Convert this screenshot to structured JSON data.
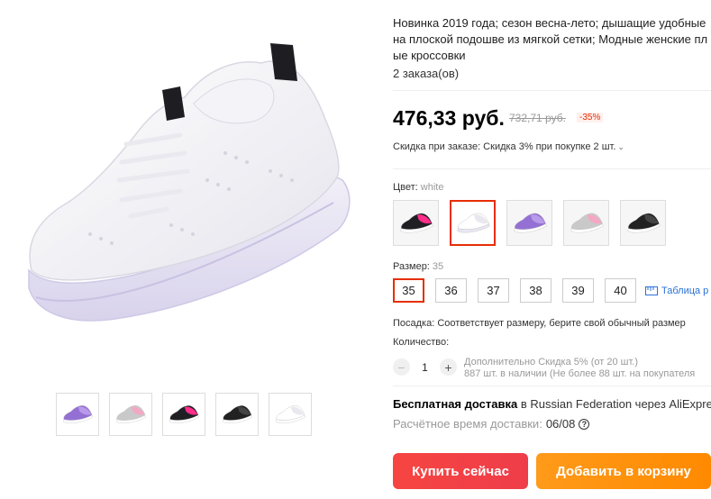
{
  "product": {
    "title_lines": [
      "Новинка 2019 года; сезон весна-лето; дышащие удобные",
      "на плоской подошве из мягкой сетки; Модные женские пл",
      "ые кроссовки"
    ],
    "orders": "2 заказа(ов)",
    "price": "476,33 руб.",
    "old_price": "732,71 руб.",
    "discount": "-35%",
    "promo": "Скидка при заказе: Скидка 3% при покупке 2 шт."
  },
  "color": {
    "label": "Цвет: ",
    "selected": "white",
    "options": [
      {
        "name": "black-pink",
        "body": "#1f1f24",
        "accent": "#ff2e8a",
        "sole": "#ffffff"
      },
      {
        "name": "white",
        "body": "#ffffff",
        "accent": "#e8e8ee",
        "sole": "#e9e6f4"
      },
      {
        "name": "purple",
        "body": "#9470d4",
        "accent": "#b89ae8",
        "sole": "#ffffff"
      },
      {
        "name": "grey-pink",
        "body": "#c9c9c9",
        "accent": "#f4a7c3",
        "sole": "#ffffff"
      },
      {
        "name": "black",
        "body": "#222222",
        "accent": "#444444",
        "sole": "#ffffff"
      }
    ]
  },
  "size": {
    "label": "Размер: ",
    "selected": "35",
    "options": [
      "35",
      "36",
      "37",
      "38",
      "39",
      "40"
    ],
    "table_link": "Таблица р"
  },
  "fit": "Посадка: Соответствует размеру, берите свой обычный размер",
  "quantity": {
    "label": "Количество:",
    "value": "1",
    "minus": "−",
    "plus": "+",
    "note_line1": "Дополнительно Скидка 5% (от 20 шт.)",
    "note_line2": "887 шт. в наличии (Не более 88 шт. на покупателя"
  },
  "shipping": {
    "bold": "Бесплатная доставка",
    "rest": " в Russian Federation через AliExpre",
    "eta_label": "Расчётное время доставки: ",
    "eta_date": "06/08",
    "help": "?"
  },
  "buttons": {
    "buy": "Купить сейчас",
    "cart": "Добавить в корзину"
  },
  "thumbnails": [
    {
      "name": "purple",
      "body": "#9470d4",
      "accent": "#b89ae8"
    },
    {
      "name": "grey-pink",
      "body": "#c9c9c9",
      "accent": "#f4a7c3"
    },
    {
      "name": "black-pink",
      "body": "#1f1f24",
      "accent": "#ff2e8a"
    },
    {
      "name": "black",
      "body": "#222222",
      "accent": "#444444"
    },
    {
      "name": "white",
      "body": "#ffffff",
      "accent": "#e8e8ee"
    }
  ],
  "colors": {
    "accent_red": "#e62e04",
    "buy_button": "#f64541",
    "cart_button": "#ff8a00",
    "link_blue": "#2a71d6"
  }
}
